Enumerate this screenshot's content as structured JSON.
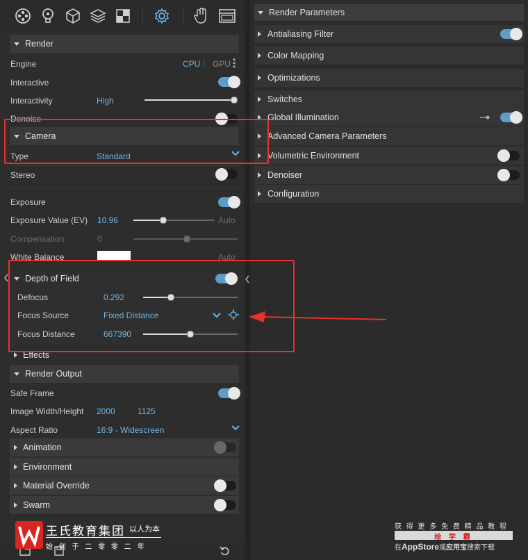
{
  "toolbar": {
    "icons": [
      "lens-icon",
      "bulb-icon",
      "cube-icon",
      "layers-icon",
      "checker-icon",
      "gear-icon",
      "hand-icon",
      "window-icon"
    ]
  },
  "left": {
    "render_header": "Render",
    "engine_label": "Engine",
    "engine_cpu": "CPU",
    "engine_gpu": "GPU",
    "interactive_label": "Interactive",
    "interactivity_label": "Interactivity",
    "interactivity_value": "High",
    "denoise_label": "Denoise",
    "camera_header": "Camera",
    "type_label": "Type",
    "type_value": "Standard",
    "stereo_label": "Stereo",
    "exposure_label": "Exposure",
    "ev_label": "Exposure Value (EV)",
    "ev_value": "10.96",
    "ev_auto": "Auto",
    "comp_label": "Compensation",
    "comp_value": "0",
    "wb_label": "White Balance",
    "wb_auto": "Auto",
    "dof_header": "Depth of Field",
    "defocus_label": "Defocus",
    "defocus_value": "0.292",
    "focus_source_label": "Focus Source",
    "focus_source_value": "Fixed Distance",
    "focus_distance_label": "Focus Distance",
    "focus_distance_value": "667390",
    "effects_header": "Effects",
    "render_output_header": "Render Output",
    "safe_frame_label": "Safe Frame",
    "image_wh_label": "Image Width/Height",
    "image_w": "2000",
    "image_h": "1125",
    "aspect_label": "Aspect Ratio",
    "aspect_value": "16:9 - Widescreen",
    "animation_header": "Animation",
    "environment_header": "Environment",
    "material_override_header": "Material Override",
    "swarm_header": "Swarm"
  },
  "right": {
    "render_parameters": "Render Parameters",
    "items": [
      {
        "label": "Antialiasing Filter",
        "toggle": "on"
      },
      {
        "label": "Color Mapping",
        "toggle": "none"
      },
      {
        "label": "Optimizations",
        "toggle": "none"
      },
      {
        "label": "Switches",
        "toggle": "none"
      },
      {
        "label": "Global Illumination",
        "toggle": "on"
      },
      {
        "label": "Advanced Camera Parameters",
        "toggle": "none"
      },
      {
        "label": "Volumetric Environment",
        "toggle": "off"
      },
      {
        "label": "Denoiser",
        "toggle": "off"
      },
      {
        "label": "Configuration",
        "toggle": "none"
      }
    ]
  },
  "watermark": {
    "brand": "王氏教育集团",
    "slogan": "以人为本",
    "subtitle": "始 创 于 二 零 零 二 年",
    "right_line1": "获 得 更 多 免 费 精 品 教 程",
    "right_line2": "绘 学 霸",
    "right_line3_a": "在",
    "right_line3_b": "AppStore",
    "right_line3_c": "或",
    "right_line3_d": "应用宝",
    "right_line3_e": "搜索下载"
  },
  "colors": {
    "accent": "#6cb6ea",
    "toggle_on": "#5d9ec9",
    "annotation_red": "#e8322b"
  }
}
